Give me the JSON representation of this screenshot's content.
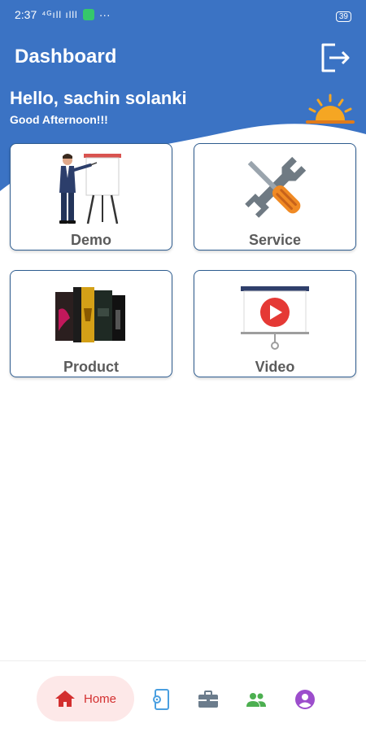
{
  "status_bar": {
    "time": "2:37",
    "glyphs": "⁴ᴳıll ılll ",
    "dots": "···",
    "battery": "39"
  },
  "header": {
    "title": "Dashboard",
    "greeting": "Hello, sachin solanki",
    "subgreeting": "Good Afternoon!!!",
    "logout_icon": "logout-icon",
    "time_of_day_icon": "sunset-icon",
    "background_color": "#3b73c4"
  },
  "cards": [
    {
      "label": "Demo",
      "icon": "presenter-icon"
    },
    {
      "label": "Service",
      "icon": "tools-icon"
    },
    {
      "label": "Product",
      "icon": "product-boxes-icon"
    },
    {
      "label": "Video",
      "icon": "video-play-icon"
    }
  ],
  "bottom_nav": {
    "items": [
      {
        "label": "Home",
        "icon": "home-icon",
        "active": true,
        "color": "#d32f2f"
      },
      {
        "label": "",
        "icon": "device-settings-icon",
        "color": "#4a9fe0"
      },
      {
        "label": "",
        "icon": "briefcase-icon",
        "color": "#6b7c8c"
      },
      {
        "label": "",
        "icon": "group-icon",
        "color": "#4caf50"
      },
      {
        "label": "",
        "icon": "profile-icon",
        "color": "#9c4dcc"
      }
    ]
  }
}
